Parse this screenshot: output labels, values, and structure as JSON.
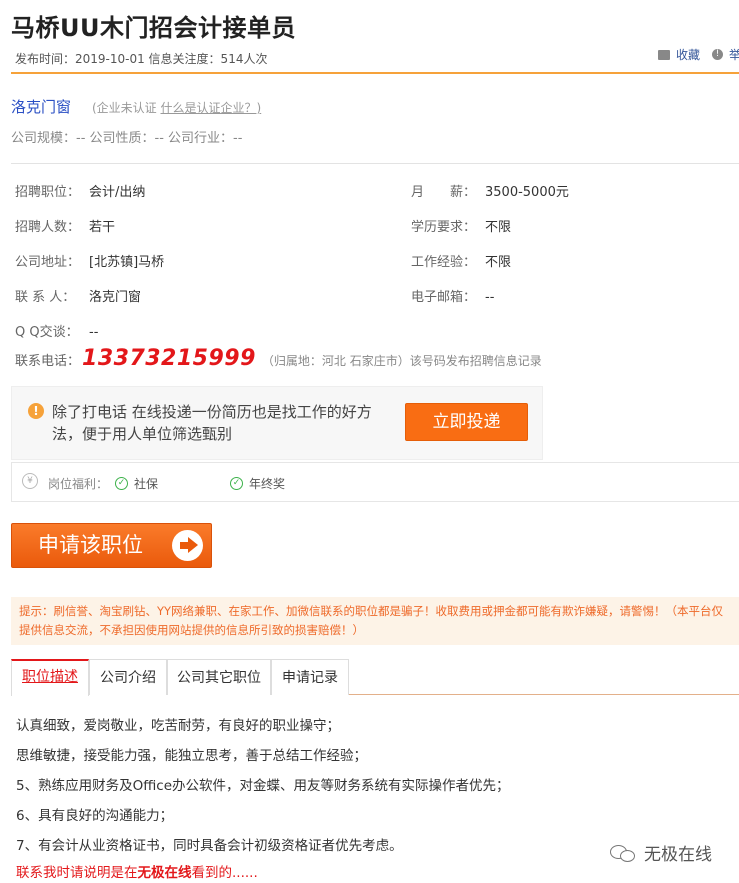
{
  "header": {
    "title": "马桥UU木门招会计接单员",
    "meta": "发布时间：2019-10-01  信息关注度：514人次",
    "favorite_label": "收藏",
    "report_label": "举报"
  },
  "company": {
    "name": "洛克门窗",
    "cert_status": "(企业未认证",
    "cert_link": "什么是认证企业？)",
    "meta": "公司规模：-- 公司性质：-- 公司行业：--"
  },
  "job": {
    "position_label": "招聘职位：",
    "position": "会计/出纳",
    "salary_label": "月　　薪：",
    "salary": "3500-5000元",
    "count_label": "招聘人数：",
    "count": "若干",
    "education_label": "学历要求：",
    "education": "不限",
    "address_label": "公司地址：",
    "address": "[北苏镇]马桥",
    "experience_label": "工作经验：",
    "experience": "不限",
    "contact_label": "联 系 人：",
    "contact": "洛克门窗",
    "email_label": "电子邮箱：",
    "email": "--",
    "qq_label": "Q Q交谈：",
    "qq": "--",
    "phone_label": "联系电话：",
    "phone": "13373215999",
    "phone_note": "（归属地：河北 石家庄市）该号码发布招聘信息记录"
  },
  "tip": {
    "icon": "exclamation-icon",
    "text": "除了打电话 在线投递一份简历也是找工作的好方法，便于用人单位筛选甄别",
    "button_label": "立即投递"
  },
  "benefits": {
    "label": "岗位福利：",
    "items": [
      "社保",
      "年终奖"
    ]
  },
  "apply": {
    "button_label": "申请该职位"
  },
  "warning": {
    "text": "提示：刷信誉、淘宝刷钻、YY网络兼职、在家工作、加微信联系的职位都是骗子！收取费用或押金都可能有欺诈嫌疑，请警惕！（本平台仅提供信息交流，不承担因使用网站提供的信息所引致的损害赔偿！）"
  },
  "tabs": [
    {
      "label": "职位描述",
      "active": true
    },
    {
      "label": "公司介绍",
      "active": false
    },
    {
      "label": "公司其它职位",
      "active": false
    },
    {
      "label": "申请记录",
      "active": false
    }
  ],
  "description": [
    "认真细致，爱岗敬业，吃苦耐劳，有良好的职业操守；",
    "思维敏捷，接受能力强，能独立思考，善于总结工作经验；",
    "5、熟练应用财务及Office办公软件，对金蝶、用友等财务系统有实际操作者优先；",
    "6、具有良好的沟通能力；",
    "7、有会计从业资格证书，同时具备会计初级资格证者优先考虑。"
  ],
  "footer": {
    "prefix": "联系我时请说明是在",
    "brand": "无极在线",
    "suffix": "看到的......"
  },
  "watermark": {
    "text": "无极在线"
  },
  "colors": {
    "accent_orange": "#f96d13",
    "phone_red": "#e3171a",
    "link_blue": "#2a4fc4"
  }
}
